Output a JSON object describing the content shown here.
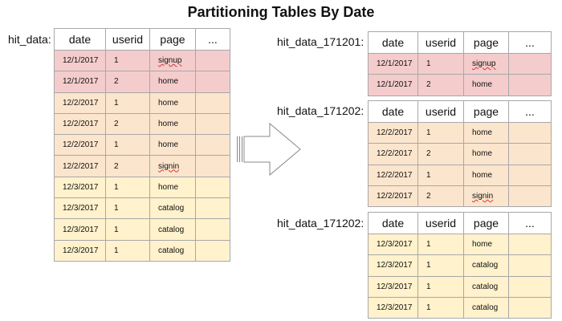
{
  "title": "Partitioning Tables By Date",
  "columns": [
    "date",
    "userid",
    "page",
    "..."
  ],
  "source": {
    "label": "hit_data:",
    "rows": [
      {
        "date": "12/1/2017",
        "userid": "1",
        "page": "signup",
        "color": "red"
      },
      {
        "date": "12/1/2017",
        "userid": "2",
        "page": "home",
        "color": "red"
      },
      {
        "date": "12/2/2017",
        "userid": "1",
        "page": "home",
        "color": "orange"
      },
      {
        "date": "12/2/2017",
        "userid": "2",
        "page": "home",
        "color": "orange"
      },
      {
        "date": "12/2/2017",
        "userid": "1",
        "page": "home",
        "color": "orange"
      },
      {
        "date": "12/2/2017",
        "userid": "2",
        "page": "signin",
        "color": "orange"
      },
      {
        "date": "12/3/2017",
        "userid": "1",
        "page": "home",
        "color": "yellow"
      },
      {
        "date": "12/3/2017",
        "userid": "1",
        "page": "catalog",
        "color": "yellow"
      },
      {
        "date": "12/3/2017",
        "userid": "1",
        "page": "catalog",
        "color": "yellow"
      },
      {
        "date": "12/3/2017",
        "userid": "1",
        "page": "catalog",
        "color": "yellow"
      }
    ]
  },
  "partitions": [
    {
      "label": "hit_data_171201:",
      "rows": [
        {
          "date": "12/1/2017",
          "userid": "1",
          "page": "signup",
          "color": "red"
        },
        {
          "date": "12/1/2017",
          "userid": "2",
          "page": "home",
          "color": "red"
        }
      ]
    },
    {
      "label": "hit_data_171202:",
      "rows": [
        {
          "date": "12/2/2017",
          "userid": "1",
          "page": "home",
          "color": "orange"
        },
        {
          "date": "12/2/2017",
          "userid": "2",
          "page": "home",
          "color": "orange"
        },
        {
          "date": "12/2/2017",
          "userid": "1",
          "page": "home",
          "color": "orange"
        },
        {
          "date": "12/2/2017",
          "userid": "2",
          "page": "signin",
          "color": "orange"
        }
      ]
    },
    {
      "label": "hit_data_171202:",
      "rows": [
        {
          "date": "12/3/2017",
          "userid": "1",
          "page": "home",
          "color": "yellow"
        },
        {
          "date": "12/3/2017",
          "userid": "1",
          "page": "catalog",
          "color": "yellow"
        },
        {
          "date": "12/3/2017",
          "userid": "1",
          "page": "catalog",
          "color": "yellow"
        },
        {
          "date": "12/3/2017",
          "userid": "1",
          "page": "catalog",
          "color": "yellow"
        }
      ]
    }
  ],
  "colors": {
    "red": "#f4cccc",
    "orange": "#fce5cd",
    "yellow": "#fff2cc"
  },
  "arrow_icon": "right-arrow-icon"
}
